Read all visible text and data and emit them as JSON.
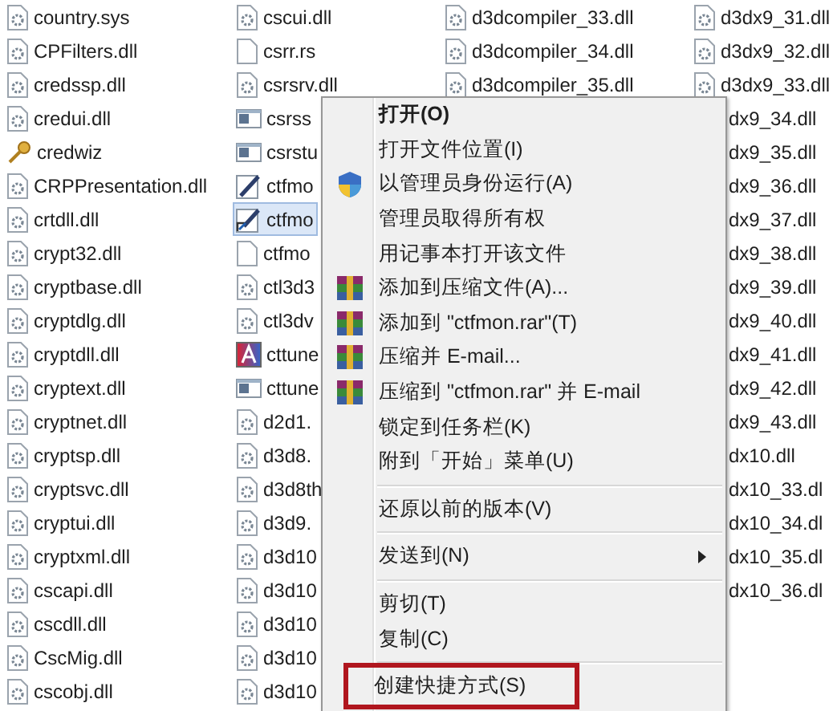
{
  "files": {
    "columns": [
      {
        "items": [
          {
            "name": "country.sys",
            "kind": "dll",
            "selected": false
          },
          {
            "name": "CPFilters.dll",
            "kind": "dll",
            "selected": false
          },
          {
            "name": "credssp.dll",
            "kind": "dll",
            "selected": false
          },
          {
            "name": "credui.dll",
            "kind": "dll",
            "selected": false
          },
          {
            "name": "credwiz",
            "kind": "wizard",
            "selected": false
          },
          {
            "name": "CRPPresentation.dll",
            "kind": "dll",
            "selected": false
          },
          {
            "name": "crtdll.dll",
            "kind": "dll",
            "selected": false
          },
          {
            "name": "crypt32.dll",
            "kind": "dll",
            "selected": false
          },
          {
            "name": "cryptbase.dll",
            "kind": "dll",
            "selected": false
          },
          {
            "name": "cryptdlg.dll",
            "kind": "dll",
            "selected": false
          },
          {
            "name": "cryptdll.dll",
            "kind": "dll",
            "selected": false
          },
          {
            "name": "cryptext.dll",
            "kind": "dll",
            "selected": false
          },
          {
            "name": "cryptnet.dll",
            "kind": "dll",
            "selected": false
          },
          {
            "name": "cryptsp.dll",
            "kind": "dll",
            "selected": false
          },
          {
            "name": "cryptsvc.dll",
            "kind": "dll",
            "selected": false
          },
          {
            "name": "cryptui.dll",
            "kind": "dll",
            "selected": false
          },
          {
            "name": "cryptxml.dll",
            "kind": "dll",
            "selected": false
          },
          {
            "name": "cscapi.dll",
            "kind": "dll",
            "selected": false
          },
          {
            "name": "cscdll.dll",
            "kind": "dll",
            "selected": false
          },
          {
            "name": "CscMig.dll",
            "kind": "dll",
            "selected": false
          },
          {
            "name": "cscobj.dll",
            "kind": "dll",
            "selected": false
          }
        ]
      },
      {
        "items": [
          {
            "name": "cscui.dll",
            "kind": "dll",
            "selected": false
          },
          {
            "name": "csrr.rs",
            "kind": "file",
            "selected": false
          },
          {
            "name": "csrsrv.dll",
            "kind": "dll",
            "selected": false
          },
          {
            "name": "csrss",
            "kind": "app",
            "selected": false
          },
          {
            "name": "csrstu",
            "kind": "app",
            "selected": false
          },
          {
            "name": "ctfmo",
            "kind": "edit",
            "selected": false
          },
          {
            "name": "ctfmo",
            "kind": "shortcut",
            "selected": true
          },
          {
            "name": "ctfmo",
            "kind": "file",
            "selected": false
          },
          {
            "name": "ctl3d3",
            "kind": "dll",
            "selected": false
          },
          {
            "name": "ctl3dv",
            "kind": "dll",
            "selected": false
          },
          {
            "name": "cttune",
            "kind": "font",
            "selected": false
          },
          {
            "name": "cttune",
            "kind": "app",
            "selected": false
          },
          {
            "name": "d2d1.",
            "kind": "dll",
            "selected": false
          },
          {
            "name": "d3d8.",
            "kind": "dll",
            "selected": false
          },
          {
            "name": "d3d8th",
            "kind": "dll",
            "selected": false
          },
          {
            "name": "d3d9.",
            "kind": "dll",
            "selected": false
          },
          {
            "name": "d3d10",
            "kind": "dll",
            "selected": false
          },
          {
            "name": "d3d10",
            "kind": "dll",
            "selected": false
          },
          {
            "name": "d3d10",
            "kind": "dll",
            "selected": false
          },
          {
            "name": "d3d10",
            "kind": "dll",
            "selected": false
          },
          {
            "name": "d3d10",
            "kind": "dll",
            "selected": false
          }
        ]
      },
      {
        "items": [
          {
            "name": "d3dcompiler_33.dll",
            "kind": "dll",
            "selected": false
          },
          {
            "name": "d3dcompiler_34.dll",
            "kind": "dll",
            "selected": false
          },
          {
            "name": "d3dcompiler_35.dll",
            "kind": "dll",
            "selected": false
          }
        ]
      },
      {
        "items": [
          {
            "name": "d3dx9_31.dll",
            "kind": "dll",
            "selected": false
          },
          {
            "name": "d3dx9_32.dll",
            "kind": "dll",
            "selected": false
          },
          {
            "name": "d3dx9_33.dll",
            "kind": "dll",
            "selected": false
          },
          {
            "name": "dx9_34.dll",
            "kind": "none",
            "selected": false
          },
          {
            "name": "dx9_35.dll",
            "kind": "none",
            "selected": false
          },
          {
            "name": "dx9_36.dll",
            "kind": "none",
            "selected": false
          },
          {
            "name": "dx9_37.dll",
            "kind": "none",
            "selected": false
          },
          {
            "name": "dx9_38.dll",
            "kind": "none",
            "selected": false
          },
          {
            "name": "dx9_39.dll",
            "kind": "none",
            "selected": false
          },
          {
            "name": "dx9_40.dll",
            "kind": "none",
            "selected": false
          },
          {
            "name": "dx9_41.dll",
            "kind": "none",
            "selected": false
          },
          {
            "name": "dx9_42.dll",
            "kind": "none",
            "selected": false
          },
          {
            "name": "dx9_43.dll",
            "kind": "none",
            "selected": false
          },
          {
            "name": "dx10.dll",
            "kind": "none",
            "selected": false
          },
          {
            "name": "dx10_33.dl",
            "kind": "none",
            "selected": false
          },
          {
            "name": "dx10_34.dl",
            "kind": "none",
            "selected": false
          },
          {
            "name": "dx10_35.dl",
            "kind": "none",
            "selected": false
          },
          {
            "name": "dx10_36.dl",
            "kind": "none",
            "selected": false
          }
        ]
      }
    ]
  },
  "context_menu": {
    "items": [
      {
        "kind": "plain",
        "label": "打开(O)",
        "default": true,
        "marked": false
      },
      {
        "kind": "plain",
        "label": "打开文件位置(I)",
        "default": false,
        "marked": false
      },
      {
        "kind": "shield",
        "label": "以管理员身份运行(A)",
        "default": false,
        "marked": false
      },
      {
        "kind": "plain",
        "label": "管理员取得所有权",
        "default": false,
        "marked": false
      },
      {
        "kind": "plain",
        "label": "用记事本打开该文件",
        "default": false,
        "marked": false
      },
      {
        "kind": "archive",
        "label": "添加到压缩文件(A)...",
        "default": false,
        "marked": false
      },
      {
        "kind": "archive",
        "label": "添加到 \"ctfmon.rar\"(T)",
        "default": false,
        "marked": false
      },
      {
        "kind": "archive",
        "label": "压缩并 E-mail...",
        "default": false,
        "marked": false
      },
      {
        "kind": "archive",
        "label": "压缩到 \"ctfmon.rar\" 并 E-mail",
        "default": false,
        "marked": false
      },
      {
        "kind": "plain",
        "label": "锁定到任务栏(K)",
        "default": false,
        "marked": false
      },
      {
        "kind": "plain",
        "label": "附到「开始」菜单(U)",
        "default": false,
        "marked": false
      },
      {
        "kind": "separator"
      },
      {
        "kind": "plain",
        "label": "还原以前的版本(V)",
        "default": false,
        "marked": false
      },
      {
        "kind": "separator"
      },
      {
        "kind": "submenu",
        "label": "发送到(N)",
        "default": false,
        "marked": false
      },
      {
        "kind": "separator"
      },
      {
        "kind": "plain",
        "label": "剪切(T)",
        "default": false,
        "marked": false
      },
      {
        "kind": "plain",
        "label": "复制(C)",
        "default": false,
        "marked": false
      },
      {
        "kind": "separator"
      },
      {
        "kind": "plain",
        "label": "创建快捷方式(S)",
        "default": false,
        "marked": true
      }
    ]
  }
}
